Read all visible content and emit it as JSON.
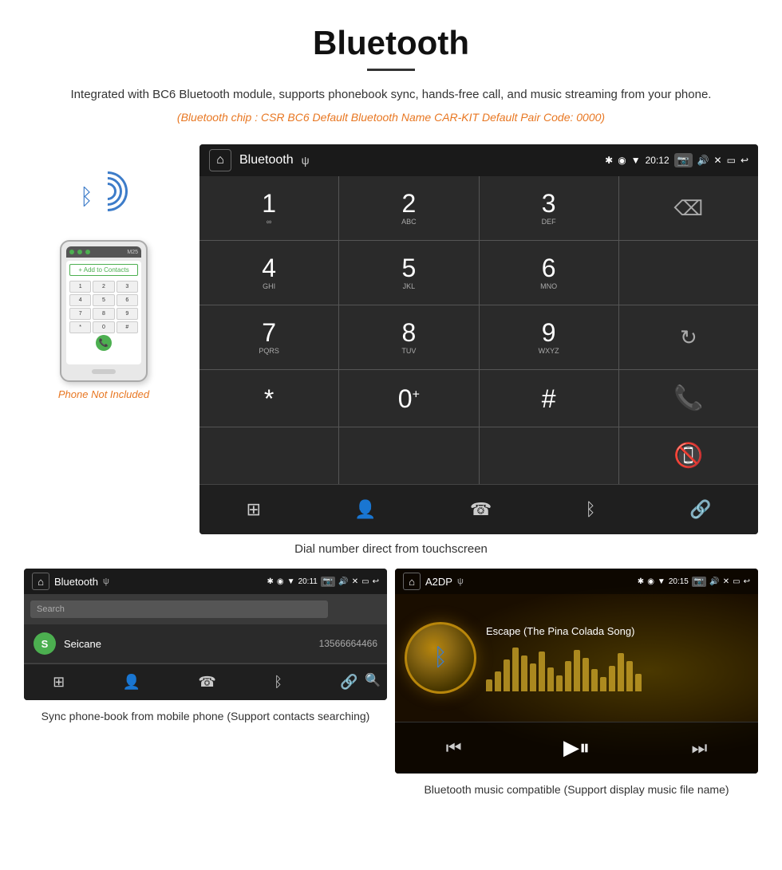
{
  "page": {
    "title": "Bluetooth",
    "subtitle": "Integrated with BC6 Bluetooth module, supports phonebook sync, hands-free call, and music streaming from your phone.",
    "spec_text": "(Bluetooth chip : CSR BC6    Default Bluetooth Name CAR-KIT    Default Pair Code: 0000)",
    "caption_main": "Dial number direct from touchscreen",
    "caption_phonebook": "Sync phone-book from mobile phone\n(Support contacts searching)",
    "caption_music": "Bluetooth music compatible\n(Support display music file name)",
    "phone_not_included": "Phone Not Included"
  },
  "dialer_screen": {
    "status_title": "Bluetooth",
    "status_usb": "ψ",
    "time": "20:12",
    "keys": [
      {
        "num": "1",
        "letters": "∞"
      },
      {
        "num": "2",
        "letters": "ABC"
      },
      {
        "num": "3",
        "letters": "DEF"
      },
      {
        "num": "",
        "letters": ""
      },
      {
        "num": "4",
        "letters": "GHI"
      },
      {
        "num": "5",
        "letters": "JKL"
      },
      {
        "num": "6",
        "letters": "MNO"
      },
      {
        "num": "",
        "letters": ""
      },
      {
        "num": "7",
        "letters": "PQRS"
      },
      {
        "num": "8",
        "letters": "TUV"
      },
      {
        "num": "9",
        "letters": "WXYZ"
      },
      {
        "num": "",
        "letters": ""
      },
      {
        "num": "*",
        "letters": ""
      },
      {
        "num": "0+",
        "letters": ""
      },
      {
        "num": "#",
        "letters": ""
      },
      {
        "num": "",
        "letters": ""
      }
    ]
  },
  "phonebook_screen": {
    "status_title": "Bluetooth",
    "time": "20:11",
    "search_placeholder": "Search",
    "contact_name": "Seicane",
    "contact_phone": "13566664466"
  },
  "music_screen": {
    "status_title": "A2DP",
    "time": "20:15",
    "song_title": "Escape (The Pina Colada Song)",
    "eq_heights": [
      15,
      25,
      40,
      55,
      45,
      35,
      50,
      30,
      20,
      38,
      52,
      42,
      28,
      18,
      32,
      48,
      38,
      22
    ]
  },
  "icons": {
    "home": "⌂",
    "bluetooth": "✱",
    "usb": "ψ",
    "bluetooth_sym": "ᛒ",
    "camera": "📷",
    "volume": "🔊",
    "close": "✕",
    "window": "▭",
    "back": "↩",
    "backspace": "⌫",
    "redial": "↻",
    "call_green": "📞",
    "call_end": "📵",
    "grid": "⊞",
    "person": "👤",
    "phone": "📱",
    "link": "🔗",
    "search": "🔍",
    "prev": "⏮",
    "play": "▶⏸",
    "next": "⏭"
  }
}
